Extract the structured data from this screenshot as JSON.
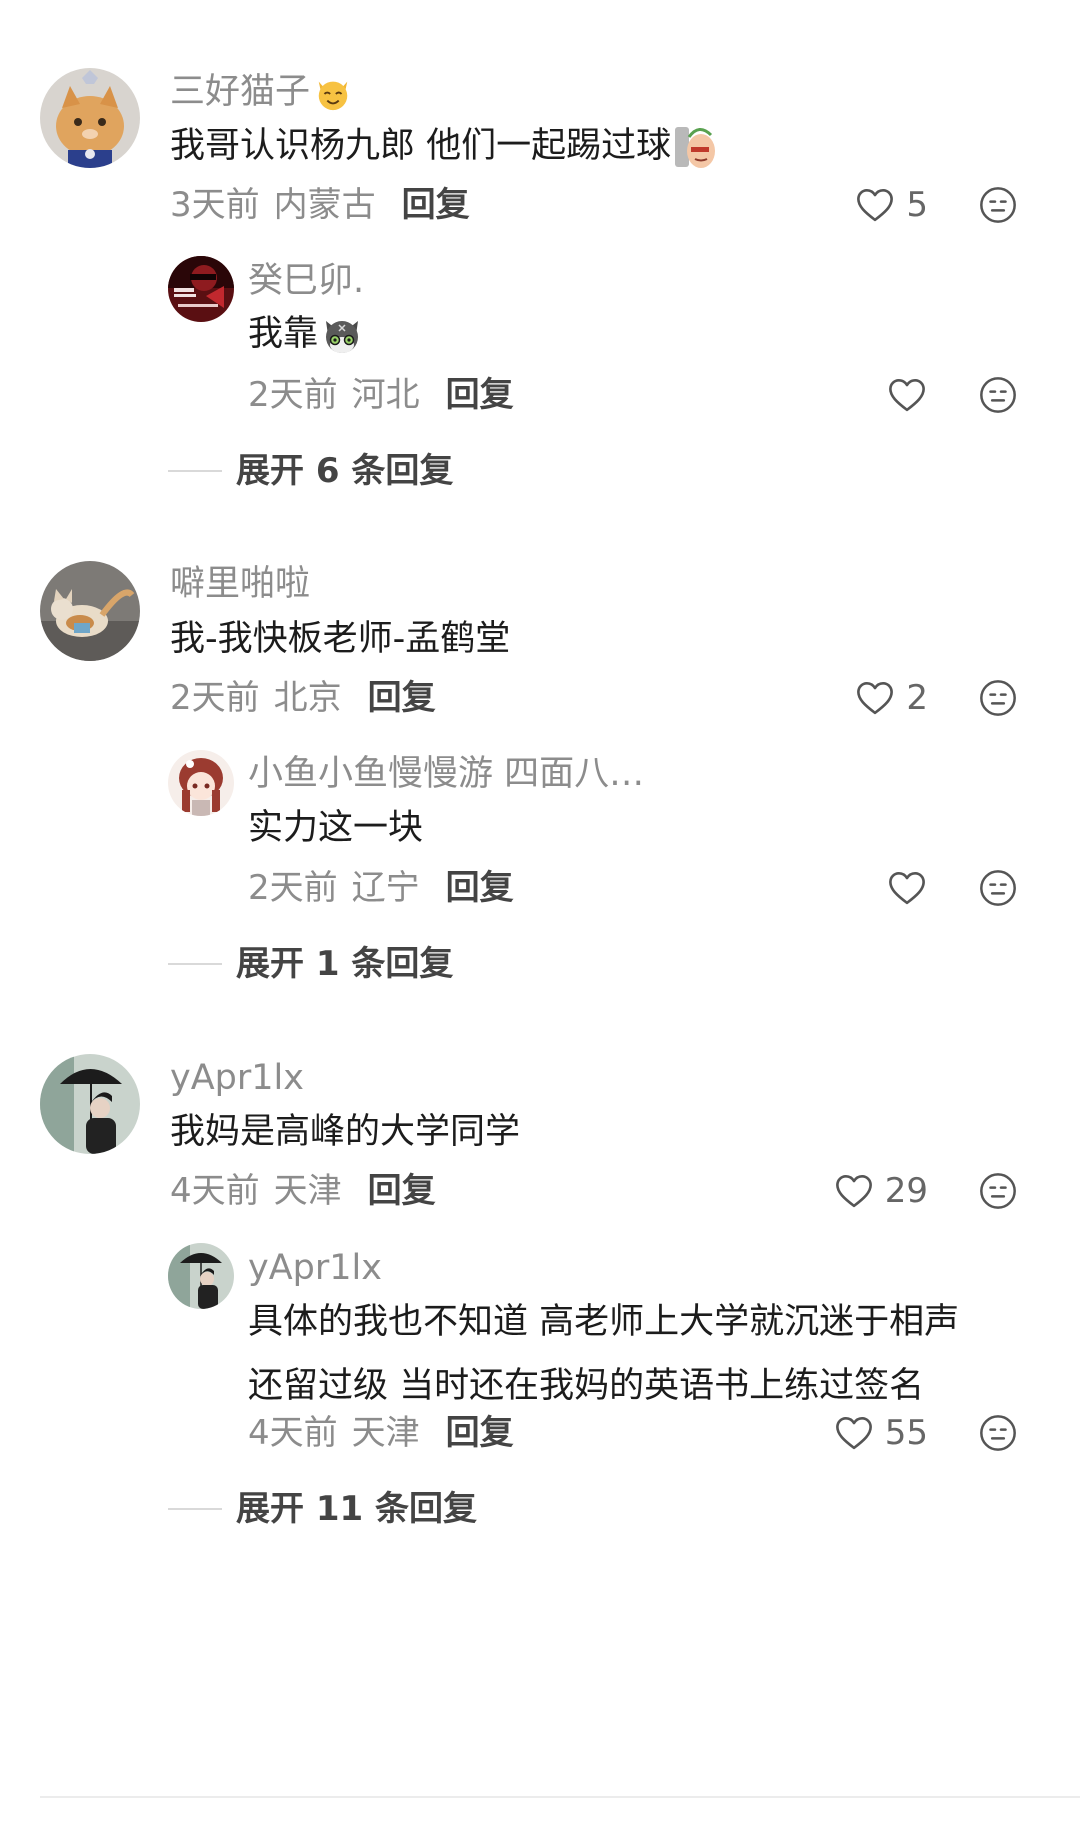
{
  "threads": [
    {
      "user": "三好猫子",
      "user_emoji": "cat-face-emoji",
      "text": "我哥认识杨九郎 他们一起踢过球",
      "text_emoji": "peeking-sticker",
      "time": "3天前",
      "region": "内蒙古",
      "reply_label": "回复",
      "likes": "5",
      "reply": {
        "user": "癸巳卯.",
        "text": "我靠",
        "text_emoji": "grey-cat-sticker",
        "time": "2天前",
        "region": "河北",
        "reply_label": "回复",
        "likes": ""
      },
      "expand_label": "展开 6 条回复"
    },
    {
      "user": "噼里啪啦",
      "text": "我-我快板老师-孟鹤堂",
      "time": "2天前",
      "region": "北京",
      "reply_label": "回复",
      "likes": "2",
      "reply": {
        "user": "小鱼小鱼慢慢游 四面八…",
        "text": "实力这一块",
        "time": "2天前",
        "region": "辽宁",
        "reply_label": "回复",
        "likes": ""
      },
      "expand_label": "展开 1 条回复"
    },
    {
      "user": "yApr1lx",
      "text": "我妈是高峰的大学同学",
      "time": "4天前",
      "region": "天津",
      "reply_label": "回复",
      "likes": "29",
      "reply": {
        "user": "yApr1lx",
        "text_line1": "具体的我也不知道 高老师上大学就沉迷于相声",
        "text_line2": "还留过级 当时还在我妈的英语书上练过签名",
        "time": "4天前",
        "region": "天津",
        "reply_label": "回复",
        "likes": "55"
      },
      "expand_label": "展开 11 条回复"
    }
  ],
  "colors": {
    "secondary_text": "#8c8c8c",
    "primary_text": "#1c1c1c",
    "action_text": "#444444",
    "icon": "#555555"
  }
}
